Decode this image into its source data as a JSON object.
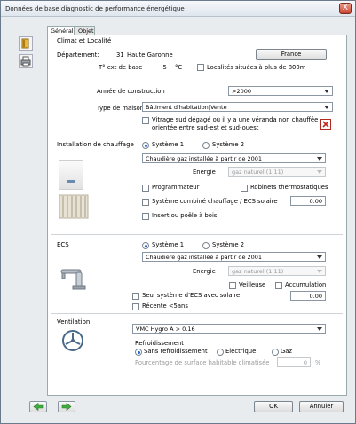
{
  "window": {
    "title": "Données de base diagnostic de performance énergétique",
    "close": "X"
  },
  "tabs": [
    {
      "label": "Général"
    },
    {
      "label": "Objet"
    }
  ],
  "climat": {
    "title": "Climat et Localité",
    "departement_label": "Département:",
    "departement_num": "31",
    "departement_name": "Haute Garonne",
    "country_button": "France",
    "temp_label": "T° ext de base",
    "temp_value": "-5",
    "temp_unit": "°C",
    "altitude_check": "Localités situées à plus de 800m"
  },
  "construction": {
    "label": "Année de construction",
    "value": ">2000"
  },
  "maison": {
    "label": "Type de maison",
    "value": "Bâtiment d'habitation|Vente",
    "vitrage_line1": "Vitrage sud dégagé où il y a une véranda non chauffée",
    "vitrage_line2": "orientée entre sud-est et sud-ouest"
  },
  "chauffage": {
    "title": "Installation de chauffage",
    "sys1": "Système 1",
    "sys2": "Système 2",
    "type": "Chaudière gaz installée à partir de 2001",
    "energie_label": "Energie",
    "energie_value": "gaz naturel (1.11)",
    "programmateur": "Programmateur",
    "robinets": "Robinets thermostatiques",
    "combine": "Système combiné chauffage / ECS solaire",
    "combine_value": "0.00",
    "insert": "Insert ou poêle à bois"
  },
  "ecs": {
    "title": "ECS",
    "sys1": "Système 1",
    "sys2": "Système 2",
    "type": "Chaudière gaz installée à partir de 2001",
    "energie_label": "Energie",
    "energie_value": "gaz naturel (1.11)",
    "veilleuse": "Veilleuse",
    "accumulation": "Accumulation",
    "solaire": "Seul système d'ECS avec solaire",
    "solaire_value": "0.00",
    "recente": "Récente <5ans"
  },
  "ventilation": {
    "title": "Ventilation",
    "type": "VMC Hygro A > 0.16",
    "refroid_title": "Refroidissement",
    "sans": "Sans refroidissement",
    "electrique": "Electrique",
    "gaz": "Gaz",
    "pourcentage": "Pourcentage de surface habitable climatisée",
    "pourcentage_value": "0",
    "pourcentage_unit": "%"
  },
  "footer": {
    "ok": "OK",
    "annuler": "Annuler"
  }
}
